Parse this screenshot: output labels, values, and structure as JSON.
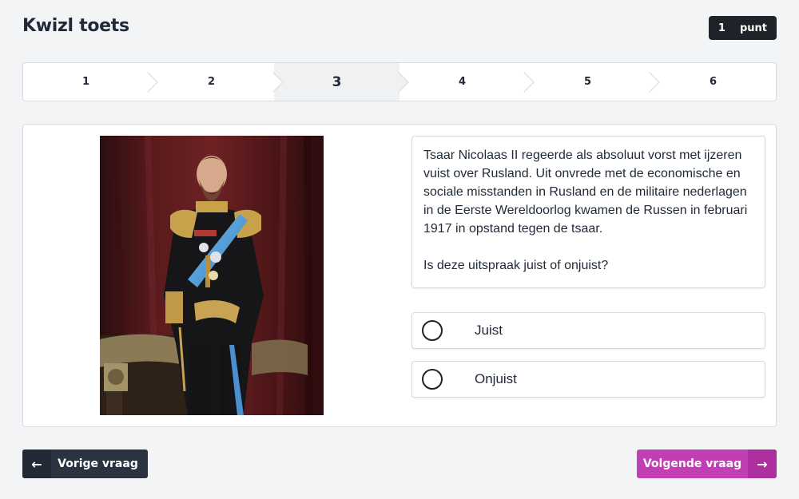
{
  "header": {
    "title": "Kwizl toets",
    "points_value": "1",
    "points_label": "punt"
  },
  "steps": [
    {
      "label": "1",
      "active": false
    },
    {
      "label": "2",
      "active": false
    },
    {
      "label": "3",
      "active": true
    },
    {
      "label": "4",
      "active": false
    },
    {
      "label": "5",
      "active": false
    },
    {
      "label": "6",
      "active": false
    }
  ],
  "question": {
    "statement": "Tsaar Nicolaas II regeerde als absoluut vorst met ijzeren vuist over Rusland. Uit onvrede met de economische en sociale misstanden in Rusland en de militaire nederlagen in de Eerste Wereldoorlog kwamen de Russen in februari 1917 in opstand tegen de tsaar.",
    "prompt": "Is deze uitspraak juist of onjuist?",
    "options": [
      {
        "label": "Juist"
      },
      {
        "label": "Onjuist"
      }
    ]
  },
  "navigation": {
    "prev_label": "Vorige vraag",
    "next_label": "Volgende vraag",
    "prev_icon": "arrow-left-icon",
    "next_icon": "arrow-right-icon"
  },
  "colors": {
    "next_button": "#c23fb3",
    "prev_button": "#2b3240"
  }
}
